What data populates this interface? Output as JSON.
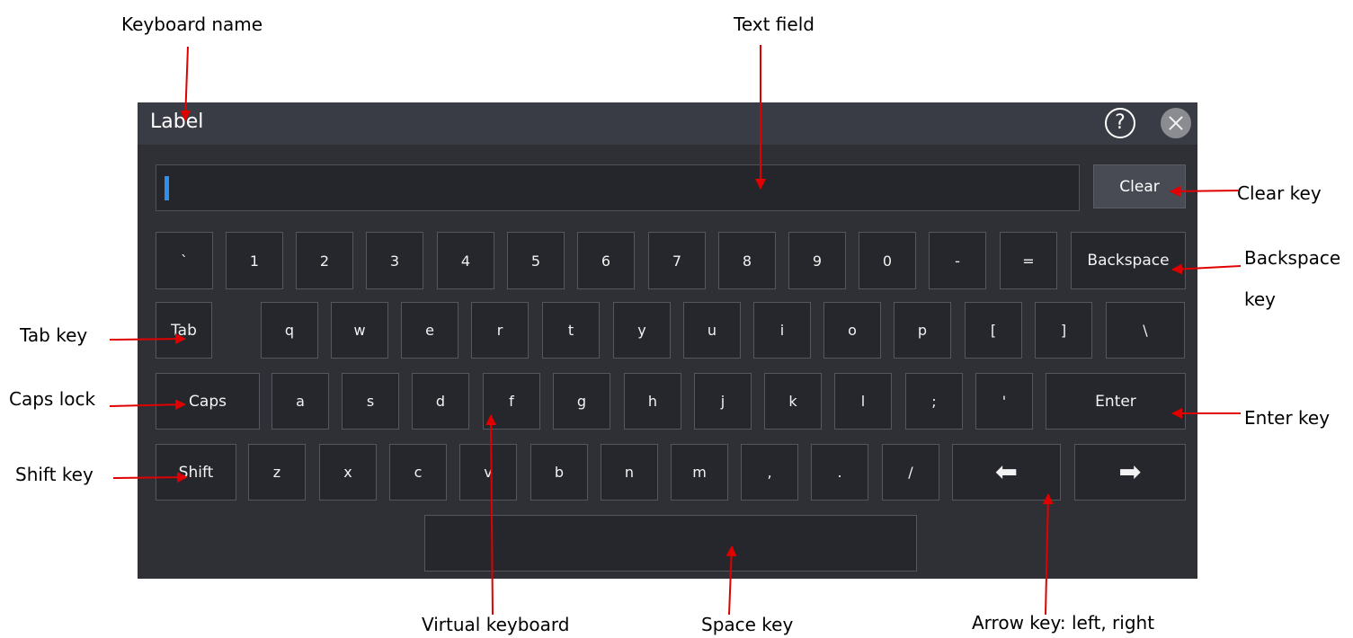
{
  "callouts": {
    "keyboard_name": "Keyboard name",
    "text_field": "Text field",
    "clear_key": "Clear key",
    "backspace_key_1": "Backspace",
    "backspace_key_2": "key",
    "tab_key": "Tab key",
    "caps_lock": "Caps lock",
    "shift_key": "Shift key",
    "enter_key": "Enter key",
    "virtual_keyboard": "Virtual keyboard",
    "space_key": "Space key",
    "arrow_keys": "Arrow key: left, right"
  },
  "keyboard": {
    "title": "Label",
    "help_symbol": "?",
    "clear_label": "Clear",
    "rows": {
      "r1": [
        "`",
        "1",
        "2",
        "3",
        "4",
        "5",
        "6",
        "7",
        "8",
        "9",
        "0",
        "-",
        "=",
        "Backspace"
      ],
      "r2": [
        "Tab",
        "q",
        "w",
        "e",
        "r",
        "t",
        "y",
        "u",
        "i",
        "o",
        "p",
        "[",
        "]",
        "\\"
      ],
      "r3": [
        "Caps",
        "a",
        "s",
        "d",
        "f",
        "g",
        "h",
        "j",
        "k",
        "l",
        ";",
        "'",
        "Enter"
      ],
      "r4": [
        "Shift",
        "z",
        "x",
        "c",
        "v",
        "b",
        "n",
        "m",
        ",",
        ".",
        "/",
        "⬅",
        "➡"
      ]
    }
  },
  "colors": {
    "window_bg": "#2e3036",
    "titlebar_bg": "#3a3c45",
    "cursor": "#2f8fef",
    "annotation_arrow": "#e00000"
  }
}
